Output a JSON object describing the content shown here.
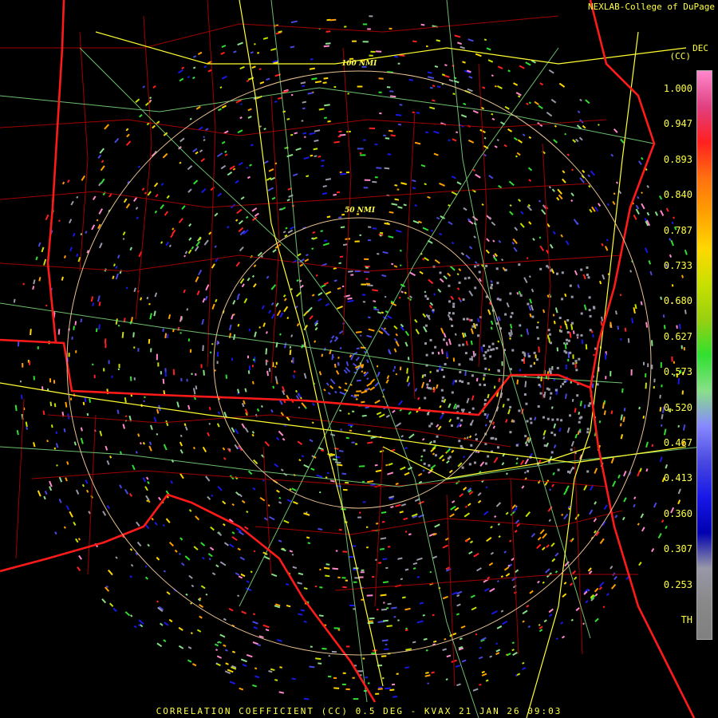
{
  "credit": "NEXLAB-College of DuPage",
  "unit_line1": "DEC",
  "unit_line2": "(CC)",
  "caption": "CORRELATION COEFFICIENT (CC) 0.5 DEG - KVAX 21 JAN 26 09:03",
  "range_rings": [
    "100 NMI",
    "50 NMI"
  ],
  "colorbar": {
    "ticks": [
      "1.000",
      "0.947",
      "0.893",
      "0.840",
      "0.787",
      "0.733",
      "0.680",
      "0.627",
      "0.573",
      "0.520",
      "0.467",
      "0.413",
      "0.360",
      "0.307",
      "0.253",
      "TH"
    ],
    "colors": [
      "#ff88cc",
      "#e04080",
      "#ff2020",
      "#ff7010",
      "#ffa000",
      "#ffd800",
      "#c8e000",
      "#98d010",
      "#30e030",
      "#88e088",
      "#8888ff",
      "#4848e0",
      "#1818e8",
      "#0000b0",
      "#9898a8",
      "#888888",
      "#808080"
    ]
  },
  "map_colors": {
    "background": "#000000",
    "state_border": "#ff1a1a",
    "county_border": "#a00000",
    "highway": "#ffff30",
    "road": "#80e080",
    "range_ring": "#e8c090"
  }
}
